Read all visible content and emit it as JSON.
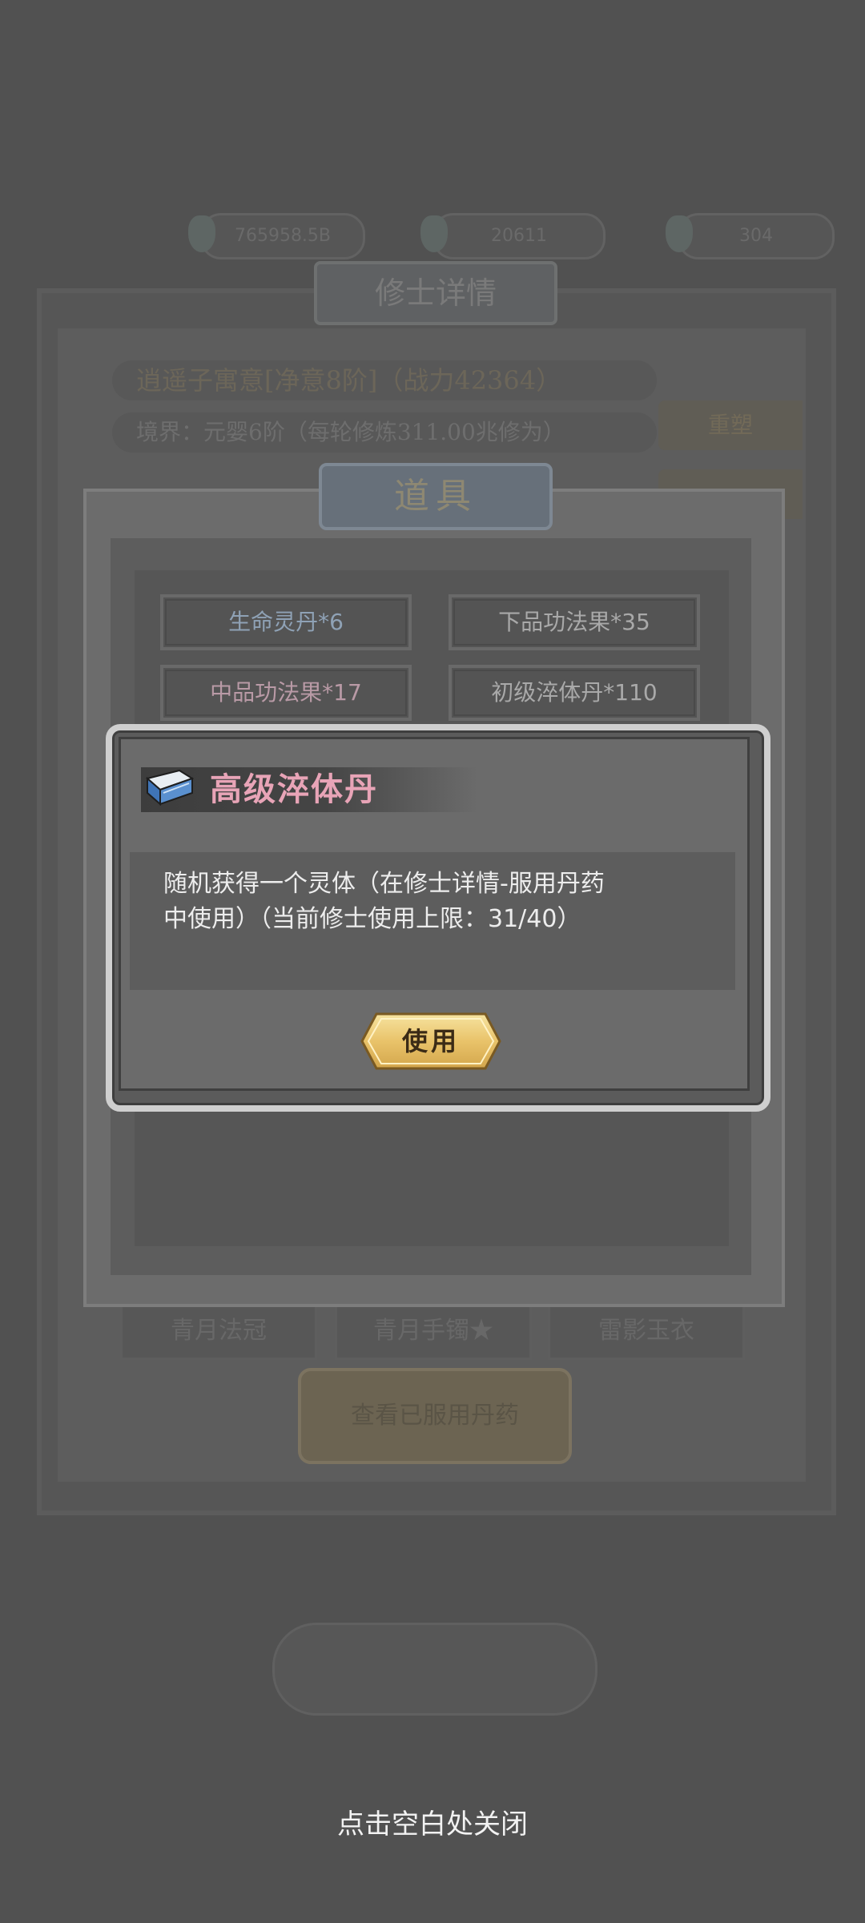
{
  "background": {
    "resources": [
      "765958.5B",
      "20611",
      "304"
    ],
    "cultivator_panel_title": "修士详情",
    "cultivator_name_line": "逍遥子寓意[净意8阶]（战力42364）",
    "realm_line": "境界：元婴6阶（每轮修炼311.00兆修为）",
    "side_buttons": [
      "重塑"
    ],
    "equipment_slots": [
      "青月法冠",
      "青月手镯★",
      "雷影玉衣"
    ],
    "view_pills_button": "查看已服用丹药"
  },
  "items_panel": {
    "title": "道具",
    "items": [
      {
        "label": "生命灵丹*6",
        "color": "#8fa2b6"
      },
      {
        "label": "下品功法果*35",
        "color": "#a9a9a9"
      },
      {
        "label": "中品功法果*17",
        "color": "#b99aa6"
      },
      {
        "label": "初级淬体丹*110",
        "color": "#a9a9a9"
      }
    ]
  },
  "dialog": {
    "icon": "book-icon",
    "title": "高级淬体丹",
    "title_color": "#e8a4b7",
    "description_line1": "随机获得一个灵体（在修士详情-服用丹药",
    "description_line2": "中使用）（当前修士使用上限：31/40）",
    "use_button": "使用"
  },
  "close_hint": "点击空白处关闭"
}
